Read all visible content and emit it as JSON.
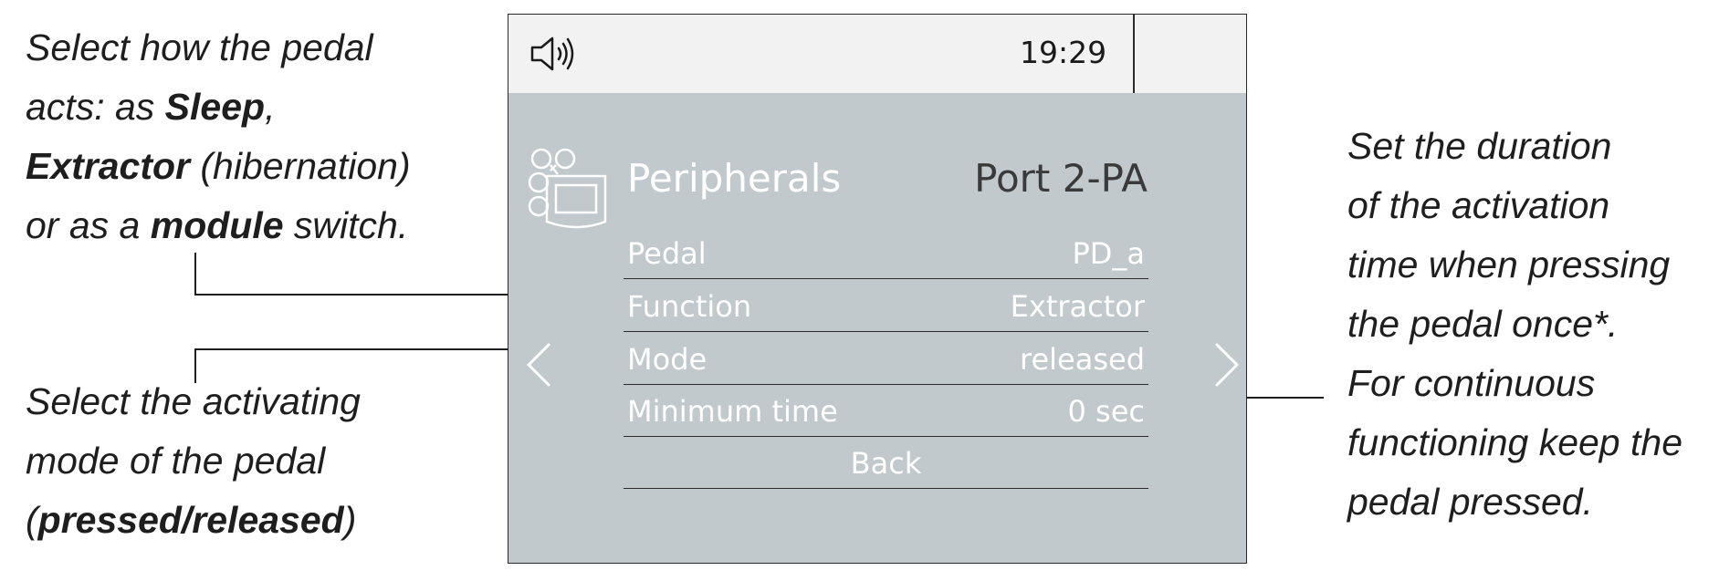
{
  "callouts": {
    "left_top": {
      "line1": "Select how the pedal",
      "line2_prefix": "acts: as ",
      "line2_bold": "Sleep",
      "line2_suffix": ",",
      "line3_bold": "Extractor",
      "line3_suffix": " (hibernation)",
      "line4_prefix": "or as a ",
      "line4_bold": "module",
      "line4_suffix": " switch."
    },
    "left_bottom": {
      "line1": "Select the activating",
      "line2": "mode of the pedal",
      "line3_prefix": "(",
      "line3_bold": "pressed/released",
      "line3_suffix": ")"
    },
    "right": {
      "lines": [
        "Set the duration",
        "of the activation",
        "time when pressing",
        "the pedal once*.",
        "For continuous",
        "functioning keep the",
        "pedal pressed."
      ]
    }
  },
  "screen": {
    "status_bar": {
      "sound_icon": "speaker-icon",
      "time": "19:29"
    },
    "menu": {
      "icon": "peripherals-icon",
      "title": "Peripherals",
      "port": "Port 2-PA",
      "rows": [
        {
          "label": "Pedal",
          "value": "PD_a"
        },
        {
          "label": "Function",
          "value": "Extractor"
        },
        {
          "label": "Mode",
          "value": "released"
        },
        {
          "label": "Minimum time",
          "value": "0 sec"
        }
      ],
      "back_label": "Back"
    },
    "nav": {
      "prev_icon": "chevron-left-icon",
      "next_icon": "chevron-right-icon"
    }
  },
  "colors": {
    "screen_background": "#c2c9cc",
    "status_bar_background": "#f2f2f2",
    "menu_text": "#ffffff",
    "port_text": "#3a3a3a",
    "callout_text": "#1e1e1e"
  }
}
